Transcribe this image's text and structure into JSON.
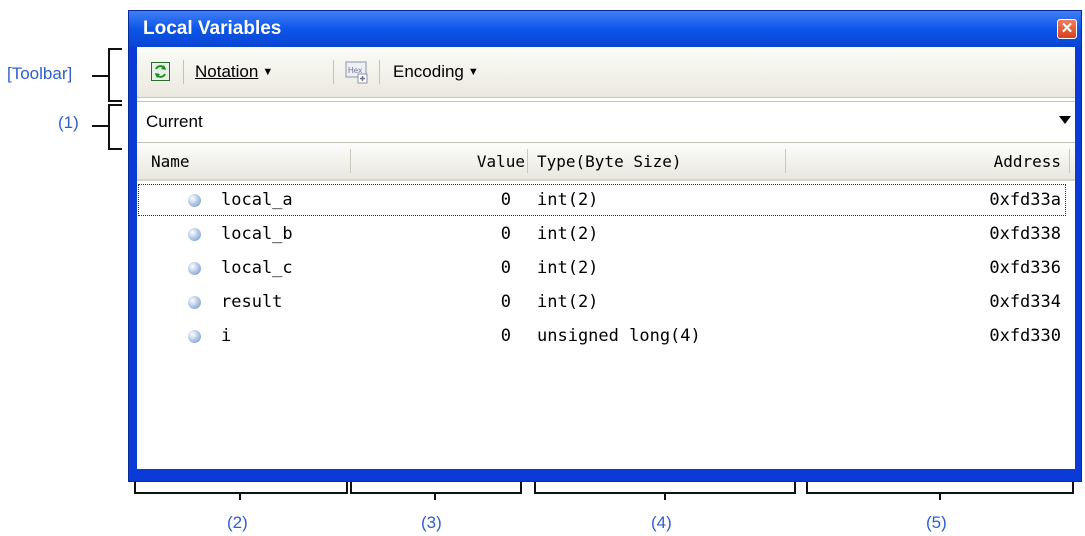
{
  "annotations": {
    "toolbar": "[Toolbar]",
    "item1": "(1)",
    "item2": "(2)",
    "item3": "(3)",
    "item4": "(4)",
    "item5": "(5)"
  },
  "window": {
    "title": "Local Variables",
    "close_icon": "close-icon"
  },
  "toolbar": {
    "refresh_icon": "refresh-icon",
    "notation_label": "Notation",
    "hex_icon": "hex-icon",
    "encoding_label": "Encoding"
  },
  "scope_combo": {
    "value": "Current"
  },
  "columns": [
    "Name",
    "Value",
    "Type(Byte Size)",
    "Address"
  ],
  "rows": [
    {
      "name": "local_a",
      "value": "0",
      "type": "int(2)",
      "address": "0xfd33a"
    },
    {
      "name": "local_b",
      "value": "0",
      "type": "int(2)",
      "address": "0xfd338"
    },
    {
      "name": "local_c",
      "value": "0",
      "type": "int(2)",
      "address": "0xfd336"
    },
    {
      "name": "result",
      "value": "0",
      "type": "int(2)",
      "address": "0xfd334"
    },
    {
      "name": "i",
      "value": "0",
      "type": "unsigned long(4)",
      "address": "0xfd330"
    }
  ]
}
